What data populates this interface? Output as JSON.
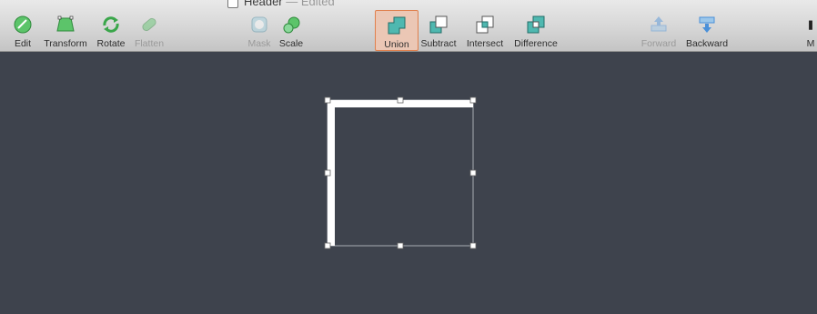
{
  "document": {
    "name": "Header",
    "separator": "—",
    "status": "Edited"
  },
  "toolbar": {
    "edit": "Edit",
    "transform": "Transform",
    "rotate": "Rotate",
    "flatten": "Flatten",
    "mask": "Mask",
    "scale": "Scale",
    "union": "Union",
    "subtract": "Subtract",
    "intersect": "Intersect",
    "difference": "Difference",
    "forward": "Forward",
    "backward": "Backward",
    "overflow": "M"
  },
  "colors": {
    "canvas": "#3e434d",
    "active_bg": "#ebc7b5",
    "active_border": "#e0804d",
    "icon_green": "#5cc46a",
    "icon_teal": "#4fb8b0",
    "icon_blue": "#4a90d9"
  }
}
